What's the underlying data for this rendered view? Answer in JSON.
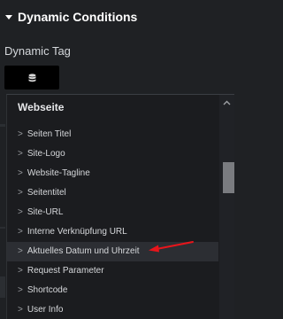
{
  "section": {
    "title": "Dynamic Conditions",
    "collapse_icon": "caret-down-icon"
  },
  "field": {
    "label": "Dynamic Tag",
    "button_icon": "database-icon"
  },
  "dropdown": {
    "group_title": "Webseite",
    "items": [
      {
        "label": "Seiten Titel"
      },
      {
        "label": "Site-Logo"
      },
      {
        "label": "Website-Tagline"
      },
      {
        "label": "Seitentitel"
      },
      {
        "label": "Site-URL"
      },
      {
        "label": "Interne Verknüpfung URL"
      },
      {
        "label": "Aktuelles Datum und Uhrzeit"
      },
      {
        "label": "Request Parameter"
      },
      {
        "label": "Shortcode"
      },
      {
        "label": "User Info"
      }
    ],
    "chevron": ">",
    "highlighted_index": 6
  },
  "colors": {
    "background": "#1f2124",
    "panel": "#1b1c1f",
    "annotation": "#e8151b"
  }
}
